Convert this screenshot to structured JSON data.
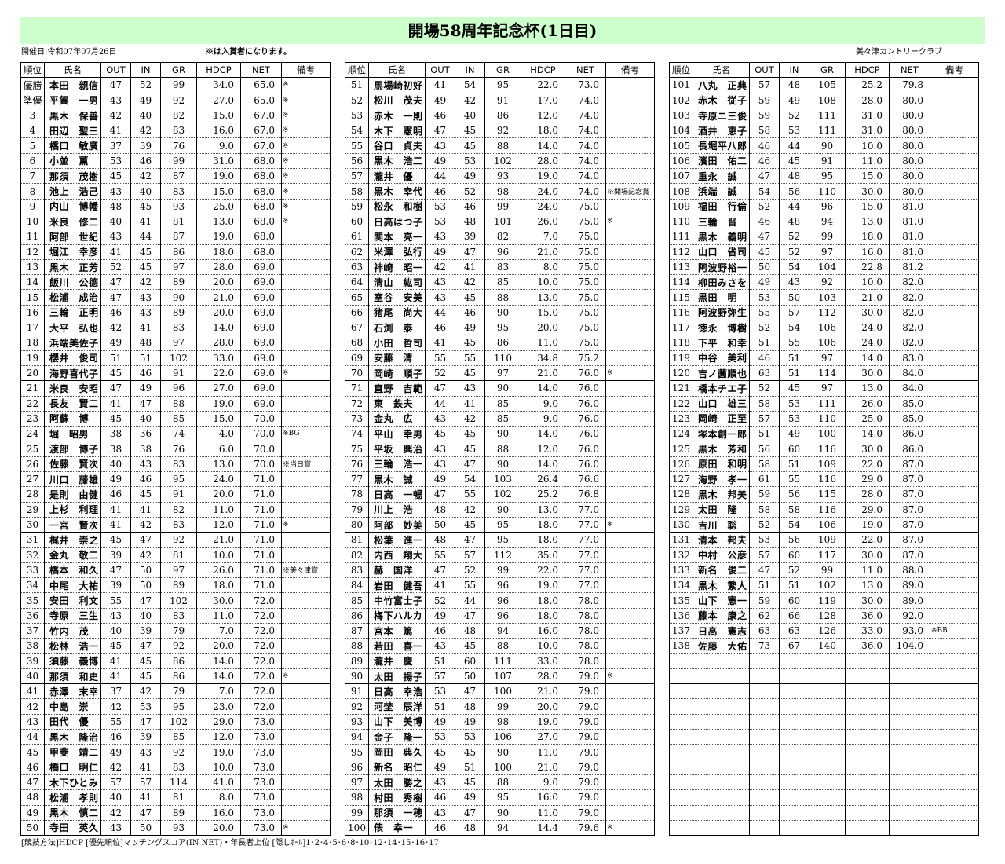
{
  "title": "開場58周年記念杯(1日目)",
  "date_label": "開催日:令和07年07月26日",
  "note_label": "※は入賞者になります。",
  "club_label": "美々津カントリークラブ",
  "headers": {
    "rank": "順位",
    "name": "氏名",
    "out": "OUT",
    "in": "IN",
    "gr": "GR",
    "hdcp": "HDCP",
    "net": "NET",
    "note": "備考"
  },
  "footer": "[競技方法]HDCP [優先順位]マッチングスコア(IN NET)・年長者上位 [隠しﾎｰﾙ]1･2･4･5･6･8･10･12･14･15･16･17",
  "players": [
    [
      "優勝",
      "本田　親信",
      "47",
      "52",
      "99",
      "34.0",
      "65.0",
      "※"
    ],
    [
      "準優",
      "平賀　一男",
      "43",
      "49",
      "92",
      "27.0",
      "65.0",
      "※"
    ],
    [
      "3",
      "黒木　保善",
      "42",
      "40",
      "82",
      "15.0",
      "67.0",
      "※"
    ],
    [
      "4",
      "田辺　聖三",
      "41",
      "42",
      "83",
      "16.0",
      "67.0",
      "※"
    ],
    [
      "5",
      "橋口　敏廣",
      "37",
      "39",
      "76",
      "9.0",
      "67.0",
      "※"
    ],
    [
      "6",
      "小並　薫",
      "53",
      "46",
      "99",
      "31.0",
      "68.0",
      "※"
    ],
    [
      "7",
      "那須　茂樹",
      "45",
      "42",
      "87",
      "19.0",
      "68.0",
      "※"
    ],
    [
      "8",
      "池上　浩己",
      "43",
      "40",
      "83",
      "15.0",
      "68.0",
      "※"
    ],
    [
      "9",
      "内山　博幡",
      "48",
      "45",
      "93",
      "25.0",
      "68.0",
      "※"
    ],
    [
      "10",
      "米良　修二",
      "40",
      "41",
      "81",
      "13.0",
      "68.0",
      "※"
    ],
    [
      "11",
      "阿部　世紀",
      "43",
      "44",
      "87",
      "19.0",
      "68.0",
      ""
    ],
    [
      "12",
      "堀江　幸彦",
      "41",
      "45",
      "86",
      "18.0",
      "68.0",
      ""
    ],
    [
      "13",
      "黒木　正芳",
      "52",
      "45",
      "97",
      "28.0",
      "69.0",
      ""
    ],
    [
      "14",
      "飯川　公德",
      "47",
      "42",
      "89",
      "20.0",
      "69.0",
      ""
    ],
    [
      "15",
      "松浦　成治",
      "47",
      "43",
      "90",
      "21.0",
      "69.0",
      ""
    ],
    [
      "16",
      "三輪　正明",
      "46",
      "43",
      "89",
      "20.0",
      "69.0",
      ""
    ],
    [
      "17",
      "大平　弘也",
      "42",
      "41",
      "83",
      "14.0",
      "69.0",
      ""
    ],
    [
      "18",
      "浜端美佐子",
      "49",
      "48",
      "97",
      "28.0",
      "69.0",
      ""
    ],
    [
      "19",
      "櫻井　俊司",
      "51",
      "51",
      "102",
      "33.0",
      "69.0",
      ""
    ],
    [
      "20",
      "海野喜代子",
      "45",
      "46",
      "91",
      "22.0",
      "69.0",
      "※"
    ],
    [
      "21",
      "米良　安昭",
      "47",
      "49",
      "96",
      "27.0",
      "69.0",
      ""
    ],
    [
      "22",
      "長友　賢二",
      "41",
      "47",
      "88",
      "19.0",
      "69.0",
      ""
    ],
    [
      "23",
      "阿蘇　博",
      "45",
      "40",
      "85",
      "15.0",
      "70.0",
      ""
    ],
    [
      "24",
      "堀　昭男",
      "38",
      "36",
      "74",
      "4.0",
      "70.0",
      "※BG"
    ],
    [
      "25",
      "渡部　博子",
      "38",
      "38",
      "76",
      "6.0",
      "70.0",
      ""
    ],
    [
      "26",
      "佐藤　賢次",
      "40",
      "43",
      "83",
      "13.0",
      "70.0",
      "※当日賞"
    ],
    [
      "27",
      "川口　藤雄",
      "49",
      "46",
      "95",
      "24.0",
      "71.0",
      ""
    ],
    [
      "28",
      "是則　由健",
      "46",
      "45",
      "91",
      "20.0",
      "71.0",
      ""
    ],
    [
      "29",
      "上杉　利理",
      "41",
      "41",
      "82",
      "11.0",
      "71.0",
      ""
    ],
    [
      "30",
      "一宮　賢次",
      "41",
      "42",
      "83",
      "12.0",
      "71.0",
      "※"
    ],
    [
      "31",
      "梶井　崇之",
      "45",
      "47",
      "92",
      "21.0",
      "71.0",
      ""
    ],
    [
      "32",
      "金丸　敬二",
      "39",
      "42",
      "81",
      "10.0",
      "71.0",
      ""
    ],
    [
      "33",
      "橋本　和久",
      "47",
      "50",
      "97",
      "26.0",
      "71.0",
      "※美々津賞"
    ],
    [
      "34",
      "中尾　大祐",
      "39",
      "50",
      "89",
      "18.0",
      "71.0",
      ""
    ],
    [
      "35",
      "安田　利文",
      "55",
      "47",
      "102",
      "30.0",
      "72.0",
      ""
    ],
    [
      "36",
      "寺原　三生",
      "43",
      "40",
      "83",
      "11.0",
      "72.0",
      ""
    ],
    [
      "37",
      "竹内　茂",
      "40",
      "39",
      "79",
      "7.0",
      "72.0",
      ""
    ],
    [
      "38",
      "松林　浩一",
      "45",
      "47",
      "92",
      "20.0",
      "72.0",
      ""
    ],
    [
      "39",
      "須藤　義博",
      "41",
      "45",
      "86",
      "14.0",
      "72.0",
      ""
    ],
    [
      "40",
      "那須　和史",
      "41",
      "45",
      "86",
      "14.0",
      "72.0",
      "※"
    ],
    [
      "41",
      "赤澤　末幸",
      "37",
      "42",
      "79",
      "7.0",
      "72.0",
      ""
    ],
    [
      "42",
      "中島　崇",
      "42",
      "53",
      "95",
      "23.0",
      "72.0",
      ""
    ],
    [
      "43",
      "田代　優",
      "55",
      "47",
      "102",
      "29.0",
      "73.0",
      ""
    ],
    [
      "44",
      "黒木　隆治",
      "46",
      "39",
      "85",
      "12.0",
      "73.0",
      ""
    ],
    [
      "45",
      "甲斐　靖二",
      "49",
      "43",
      "92",
      "19.0",
      "73.0",
      ""
    ],
    [
      "46",
      "橋口　明仁",
      "42",
      "41",
      "83",
      "10.0",
      "73.0",
      ""
    ],
    [
      "47",
      "木下ひとみ",
      "57",
      "57",
      "114",
      "41.0",
      "73.0",
      ""
    ],
    [
      "48",
      "松浦　孝則",
      "40",
      "41",
      "81",
      "8.0",
      "73.0",
      ""
    ],
    [
      "49",
      "黒木　慎二",
      "42",
      "47",
      "89",
      "16.0",
      "73.0",
      ""
    ],
    [
      "50",
      "寺田　英久",
      "43",
      "50",
      "93",
      "20.0",
      "73.0",
      "※"
    ],
    [
      "51",
      "馬場崎初好",
      "41",
      "54",
      "95",
      "22.0",
      "73.0",
      ""
    ],
    [
      "52",
      "松川　茂夫",
      "49",
      "42",
      "91",
      "17.0",
      "74.0",
      ""
    ],
    [
      "53",
      "赤木　一則",
      "46",
      "40",
      "86",
      "12.0",
      "74.0",
      ""
    ],
    [
      "54",
      "木下　憲明",
      "47",
      "45",
      "92",
      "18.0",
      "74.0",
      ""
    ],
    [
      "55",
      "谷口　貞夫",
      "43",
      "45",
      "88",
      "14.0",
      "74.0",
      ""
    ],
    [
      "56",
      "黒木　浩二",
      "49",
      "53",
      "102",
      "28.0",
      "74.0",
      ""
    ],
    [
      "57",
      "瀧井　優",
      "44",
      "49",
      "93",
      "19.0",
      "74.0",
      ""
    ],
    [
      "58",
      "黒木　幸代",
      "46",
      "52",
      "98",
      "24.0",
      "74.0",
      "※開場記念賞"
    ],
    [
      "59",
      "松永　和樹",
      "53",
      "46",
      "99",
      "24.0",
      "75.0",
      ""
    ],
    [
      "60",
      "日高はつ子",
      "53",
      "48",
      "101",
      "26.0",
      "75.0",
      "※"
    ],
    [
      "61",
      "関本　亮一",
      "43",
      "39",
      "82",
      "7.0",
      "75.0",
      ""
    ],
    [
      "62",
      "米澤　弘行",
      "49",
      "47",
      "96",
      "21.0",
      "75.0",
      ""
    ],
    [
      "63",
      "神崎　昭一",
      "42",
      "41",
      "83",
      "8.0",
      "75.0",
      ""
    ],
    [
      "64",
      "清山　紘司",
      "43",
      "42",
      "85",
      "10.0",
      "75.0",
      ""
    ],
    [
      "65",
      "室谷　安美",
      "43",
      "45",
      "88",
      "13.0",
      "75.0",
      ""
    ],
    [
      "66",
      "猪尾　尚大",
      "44",
      "46",
      "90",
      "15.0",
      "75.0",
      ""
    ],
    [
      "67",
      "石渕　泰",
      "46",
      "49",
      "95",
      "20.0",
      "75.0",
      ""
    ],
    [
      "68",
      "小田　哲司",
      "41",
      "45",
      "86",
      "11.0",
      "75.0",
      ""
    ],
    [
      "69",
      "安藤　清",
      "55",
      "55",
      "110",
      "34.8",
      "75.2",
      ""
    ],
    [
      "70",
      "岡崎　順子",
      "52",
      "45",
      "97",
      "21.0",
      "76.0",
      "※"
    ],
    [
      "71",
      "直野　吉範",
      "47",
      "43",
      "90",
      "14.0",
      "76.0",
      ""
    ],
    [
      "72",
      "東　鉄夫",
      "44",
      "41",
      "85",
      "9.0",
      "76.0",
      ""
    ],
    [
      "73",
      "金丸　広",
      "43",
      "42",
      "85",
      "9.0",
      "76.0",
      ""
    ],
    [
      "74",
      "平山　幸男",
      "45",
      "45",
      "90",
      "14.0",
      "76.0",
      ""
    ],
    [
      "75",
      "平坂　興治",
      "43",
      "45",
      "88",
      "12.0",
      "76.0",
      ""
    ],
    [
      "76",
      "三輪　浩一",
      "43",
      "47",
      "90",
      "14.0",
      "76.0",
      ""
    ],
    [
      "77",
      "黒木　誠",
      "49",
      "54",
      "103",
      "26.4",
      "76.6",
      ""
    ],
    [
      "78",
      "日高　一暢",
      "47",
      "55",
      "102",
      "25.2",
      "76.8",
      ""
    ],
    [
      "79",
      "川上　浩",
      "48",
      "42",
      "90",
      "13.0",
      "77.0",
      ""
    ],
    [
      "80",
      "阿部　妙美",
      "50",
      "45",
      "95",
      "18.0",
      "77.0",
      "※"
    ],
    [
      "81",
      "松葉　進一",
      "48",
      "47",
      "95",
      "18.0",
      "77.0",
      ""
    ],
    [
      "82",
      "内西　翔大",
      "55",
      "57",
      "112",
      "35.0",
      "77.0",
      ""
    ],
    [
      "83",
      "赫　国洋",
      "47",
      "52",
      "99",
      "22.0",
      "77.0",
      ""
    ],
    [
      "84",
      "岩田　健吾",
      "41",
      "55",
      "96",
      "19.0",
      "77.0",
      ""
    ],
    [
      "85",
      "中竹富士子",
      "52",
      "44",
      "96",
      "18.0",
      "78.0",
      ""
    ],
    [
      "86",
      "梅下ハルカ",
      "49",
      "47",
      "96",
      "18.0",
      "78.0",
      ""
    ],
    [
      "87",
      "宮本　篤",
      "46",
      "48",
      "94",
      "16.0",
      "78.0",
      ""
    ],
    [
      "88",
      "若田　喜一",
      "43",
      "45",
      "88",
      "10.0",
      "78.0",
      ""
    ],
    [
      "89",
      "瀧井　慶",
      "51",
      "60",
      "111",
      "33.0",
      "78.0",
      ""
    ],
    [
      "90",
      "太田　揚子",
      "57",
      "50",
      "107",
      "28.0",
      "79.0",
      "※"
    ],
    [
      "91",
      "日高　幸浩",
      "53",
      "47",
      "100",
      "21.0",
      "79.0",
      ""
    ],
    [
      "92",
      "河埜　辰洋",
      "51",
      "48",
      "99",
      "20.0",
      "79.0",
      ""
    ],
    [
      "93",
      "山下　美博",
      "49",
      "49",
      "98",
      "19.0",
      "79.0",
      ""
    ],
    [
      "94",
      "金子　隆一",
      "53",
      "53",
      "106",
      "27.0",
      "79.0",
      ""
    ],
    [
      "95",
      "岡田　典久",
      "45",
      "45",
      "90",
      "11.0",
      "79.0",
      ""
    ],
    [
      "96",
      "新名　昭仁",
      "49",
      "51",
      "100",
      "21.0",
      "79.0",
      ""
    ],
    [
      "97",
      "太田　勝之",
      "43",
      "45",
      "88",
      "9.0",
      "79.0",
      ""
    ],
    [
      "98",
      "村田　秀樹",
      "46",
      "49",
      "95",
      "16.0",
      "79.0",
      ""
    ],
    [
      "99",
      "那須　一穂",
      "43",
      "47",
      "90",
      "11.0",
      "79.0",
      ""
    ],
    [
      "100",
      "俵　幸一",
      "46",
      "48",
      "94",
      "14.4",
      "79.6",
      "※"
    ],
    [
      "101",
      "八丸　正典",
      "57",
      "48",
      "105",
      "25.2",
      "79.8",
      ""
    ],
    [
      "102",
      "赤木　従子",
      "59",
      "49",
      "108",
      "28.0",
      "80.0",
      ""
    ],
    [
      "103",
      "寺原ニ三俊",
      "59",
      "52",
      "111",
      "31.0",
      "80.0",
      ""
    ],
    [
      "104",
      "酒井　恵子",
      "58",
      "53",
      "111",
      "31.0",
      "80.0",
      ""
    ],
    [
      "105",
      "長堀平八郎",
      "46",
      "44",
      "90",
      "10.0",
      "80.0",
      ""
    ],
    [
      "106",
      "濱田　佑二",
      "46",
      "45",
      "91",
      "11.0",
      "80.0",
      ""
    ],
    [
      "107",
      "重永　誠",
      "47",
      "48",
      "95",
      "15.0",
      "80.0",
      ""
    ],
    [
      "108",
      "浜端　誠",
      "54",
      "56",
      "110",
      "30.0",
      "80.0",
      ""
    ],
    [
      "109",
      "福田　行倫",
      "52",
      "44",
      "96",
      "15.0",
      "81.0",
      ""
    ],
    [
      "110",
      "三輪　晋",
      "46",
      "48",
      "94",
      "13.0",
      "81.0",
      ""
    ],
    [
      "111",
      "黒木　義明",
      "47",
      "52",
      "99",
      "18.0",
      "81.0",
      ""
    ],
    [
      "112",
      "山口　省司",
      "45",
      "52",
      "97",
      "16.0",
      "81.0",
      ""
    ],
    [
      "113",
      "阿波野裕一",
      "50",
      "54",
      "104",
      "22.8",
      "81.2",
      ""
    ],
    [
      "114",
      "柳田みさを",
      "49",
      "43",
      "92",
      "10.0",
      "82.0",
      ""
    ],
    [
      "115",
      "黒田　明",
      "53",
      "50",
      "103",
      "21.0",
      "82.0",
      ""
    ],
    [
      "116",
      "阿波野弥生",
      "55",
      "57",
      "112",
      "30.0",
      "82.0",
      ""
    ],
    [
      "117",
      "徳永　博樹",
      "52",
      "54",
      "106",
      "24.0",
      "82.0",
      ""
    ],
    [
      "118",
      "下平　和幸",
      "51",
      "55",
      "106",
      "24.0",
      "82.0",
      ""
    ],
    [
      "119",
      "中谷　美利",
      "46",
      "51",
      "97",
      "14.0",
      "83.0",
      ""
    ],
    [
      "120",
      "吉ノ薗順也",
      "63",
      "51",
      "114",
      "30.0",
      "84.0",
      ""
    ],
    [
      "121",
      "橋本チエ子",
      "52",
      "45",
      "97",
      "13.0",
      "84.0",
      ""
    ],
    [
      "122",
      "山口　雄三",
      "58",
      "53",
      "111",
      "26.0",
      "85.0",
      ""
    ],
    [
      "123",
      "岡崎　正至",
      "57",
      "53",
      "110",
      "25.0",
      "85.0",
      ""
    ],
    [
      "124",
      "塚本創一郎",
      "51",
      "49",
      "100",
      "14.0",
      "86.0",
      ""
    ],
    [
      "125",
      "黒木　芳和",
      "56",
      "60",
      "116",
      "30.0",
      "86.0",
      ""
    ],
    [
      "126",
      "原田　和明",
      "58",
      "51",
      "109",
      "22.0",
      "87.0",
      ""
    ],
    [
      "127",
      "海野　孝一",
      "61",
      "55",
      "116",
      "29.0",
      "87.0",
      ""
    ],
    [
      "128",
      "黒木　邦美",
      "59",
      "56",
      "115",
      "28.0",
      "87.0",
      ""
    ],
    [
      "129",
      "太田　隆",
      "58",
      "58",
      "116",
      "29.0",
      "87.0",
      ""
    ],
    [
      "130",
      "吉川　聡",
      "52",
      "54",
      "106",
      "19.0",
      "87.0",
      ""
    ],
    [
      "131",
      "清本　邦夫",
      "53",
      "56",
      "109",
      "22.0",
      "87.0",
      ""
    ],
    [
      "132",
      "中村　公彦",
      "57",
      "60",
      "117",
      "30.0",
      "87.0",
      ""
    ],
    [
      "133",
      "新名　俊二",
      "47",
      "52",
      "99",
      "11.0",
      "88.0",
      ""
    ],
    [
      "134",
      "黒木　繁人",
      "51",
      "51",
      "102",
      "13.0",
      "89.0",
      ""
    ],
    [
      "135",
      "山下　憲一",
      "59",
      "60",
      "119",
      "30.0",
      "89.0",
      ""
    ],
    [
      "136",
      "藤本　康之",
      "62",
      "66",
      "128",
      "36.0",
      "92.0",
      ""
    ],
    [
      "137",
      "日高　憲志",
      "63",
      "63",
      "126",
      "33.0",
      "93.0",
      "※BB"
    ],
    [
      "138",
      "佐藤　大佑",
      "73",
      "67",
      "140",
      "36.0",
      "104.0",
      ""
    ]
  ]
}
